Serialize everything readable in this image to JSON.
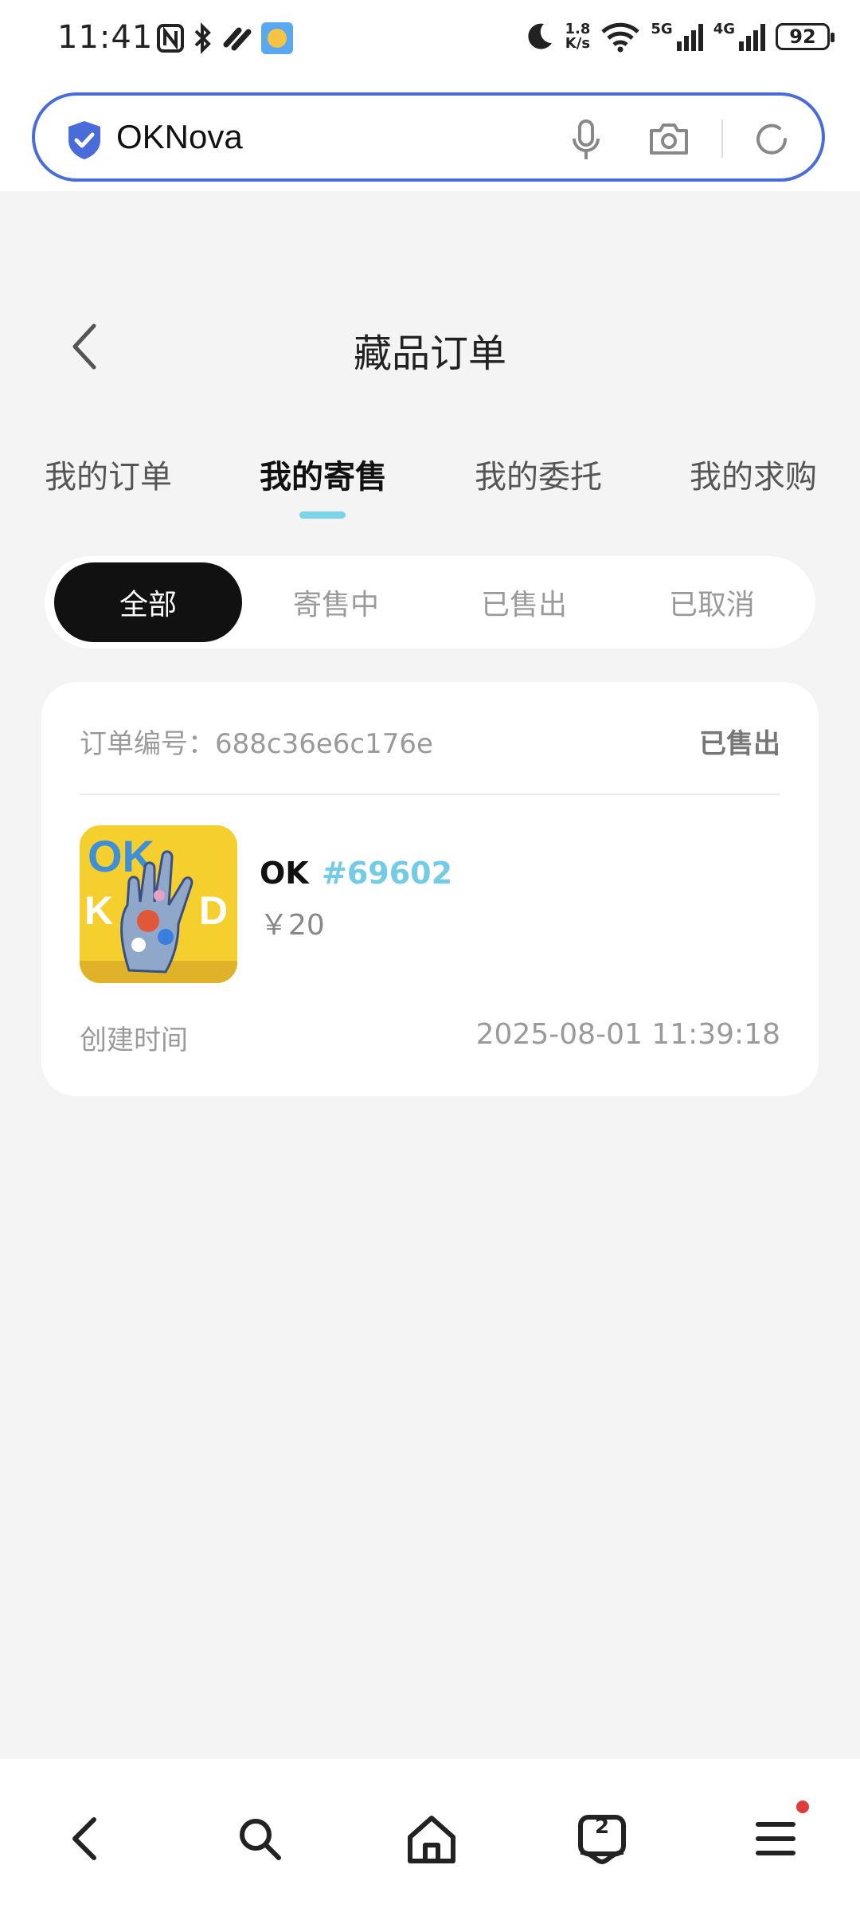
{
  "status_bar": {
    "time": "11:41",
    "net_speed_value": "1.8",
    "net_speed_unit": "K/s",
    "network_5g": "5G",
    "network_4g": "4G",
    "battery": "92",
    "icons": [
      "nfc-icon",
      "bluetooth-icon",
      "link-icon",
      "weather-icon",
      "moon-icon",
      "wifi-icon",
      "signal-icon",
      "battery-icon"
    ]
  },
  "browser": {
    "address_text": "OKNova",
    "accent_color": "#4a6cd8",
    "icons": [
      "shield-icon",
      "mic-icon",
      "camera-icon",
      "reload-icon"
    ]
  },
  "header": {
    "title": "藏品订单"
  },
  "tabs": [
    {
      "label": "我的订单",
      "active": false
    },
    {
      "label": "我的寄售",
      "active": true
    },
    {
      "label": "我的委托",
      "active": false
    },
    {
      "label": "我的求购",
      "active": false
    }
  ],
  "filters": [
    {
      "label": "全部",
      "active": true
    },
    {
      "label": "寄售中",
      "active": false
    },
    {
      "label": "已售出",
      "active": false
    },
    {
      "label": "已取消",
      "active": false
    }
  ],
  "order": {
    "order_no_label": "订单编号：",
    "order_no": "688c36e6c176e",
    "status": "已售出",
    "item_name": "OK",
    "item_tag": "#69602",
    "price": "￥20",
    "created_label": "创建时间",
    "created_value": "2025-08-01 11:39:18"
  },
  "bottom_nav": {
    "tab_count": "2",
    "icons": [
      "back-icon",
      "search-icon",
      "home-icon",
      "tabs-icon",
      "menu-icon"
    ]
  }
}
